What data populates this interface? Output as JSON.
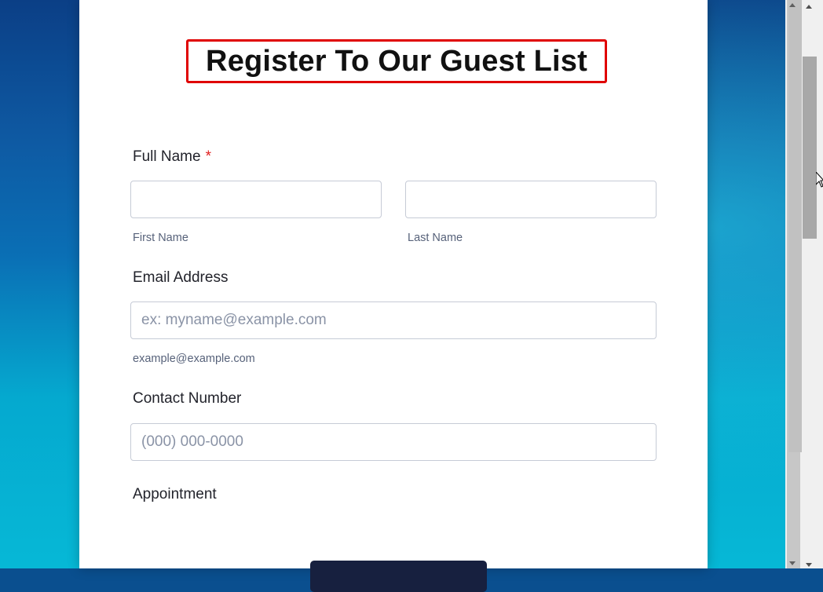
{
  "form": {
    "title": "Register To Our Guest List",
    "full_name": {
      "label": "Full Name",
      "required_mark": "*",
      "first_name_sublabel": "First Name",
      "last_name_sublabel": "Last Name",
      "first_name_value": "",
      "last_name_value": ""
    },
    "email": {
      "label": "Email Address",
      "placeholder": "ex: myname@example.com",
      "sublabel": "example@example.com",
      "value": ""
    },
    "contact": {
      "label": "Contact Number",
      "placeholder": "(000) 000-0000",
      "value": ""
    },
    "appointment": {
      "label": "Appointment"
    },
    "submit_label": ""
  },
  "colors": {
    "title_highlight_border": "#e00000",
    "required_mark": "#e02020",
    "submit_button": "#17203f"
  },
  "icons": {
    "scroll_up": "scroll-up-arrow-icon",
    "scroll_down": "scroll-down-arrow-icon",
    "cursor": "mouse-pointer-icon"
  }
}
